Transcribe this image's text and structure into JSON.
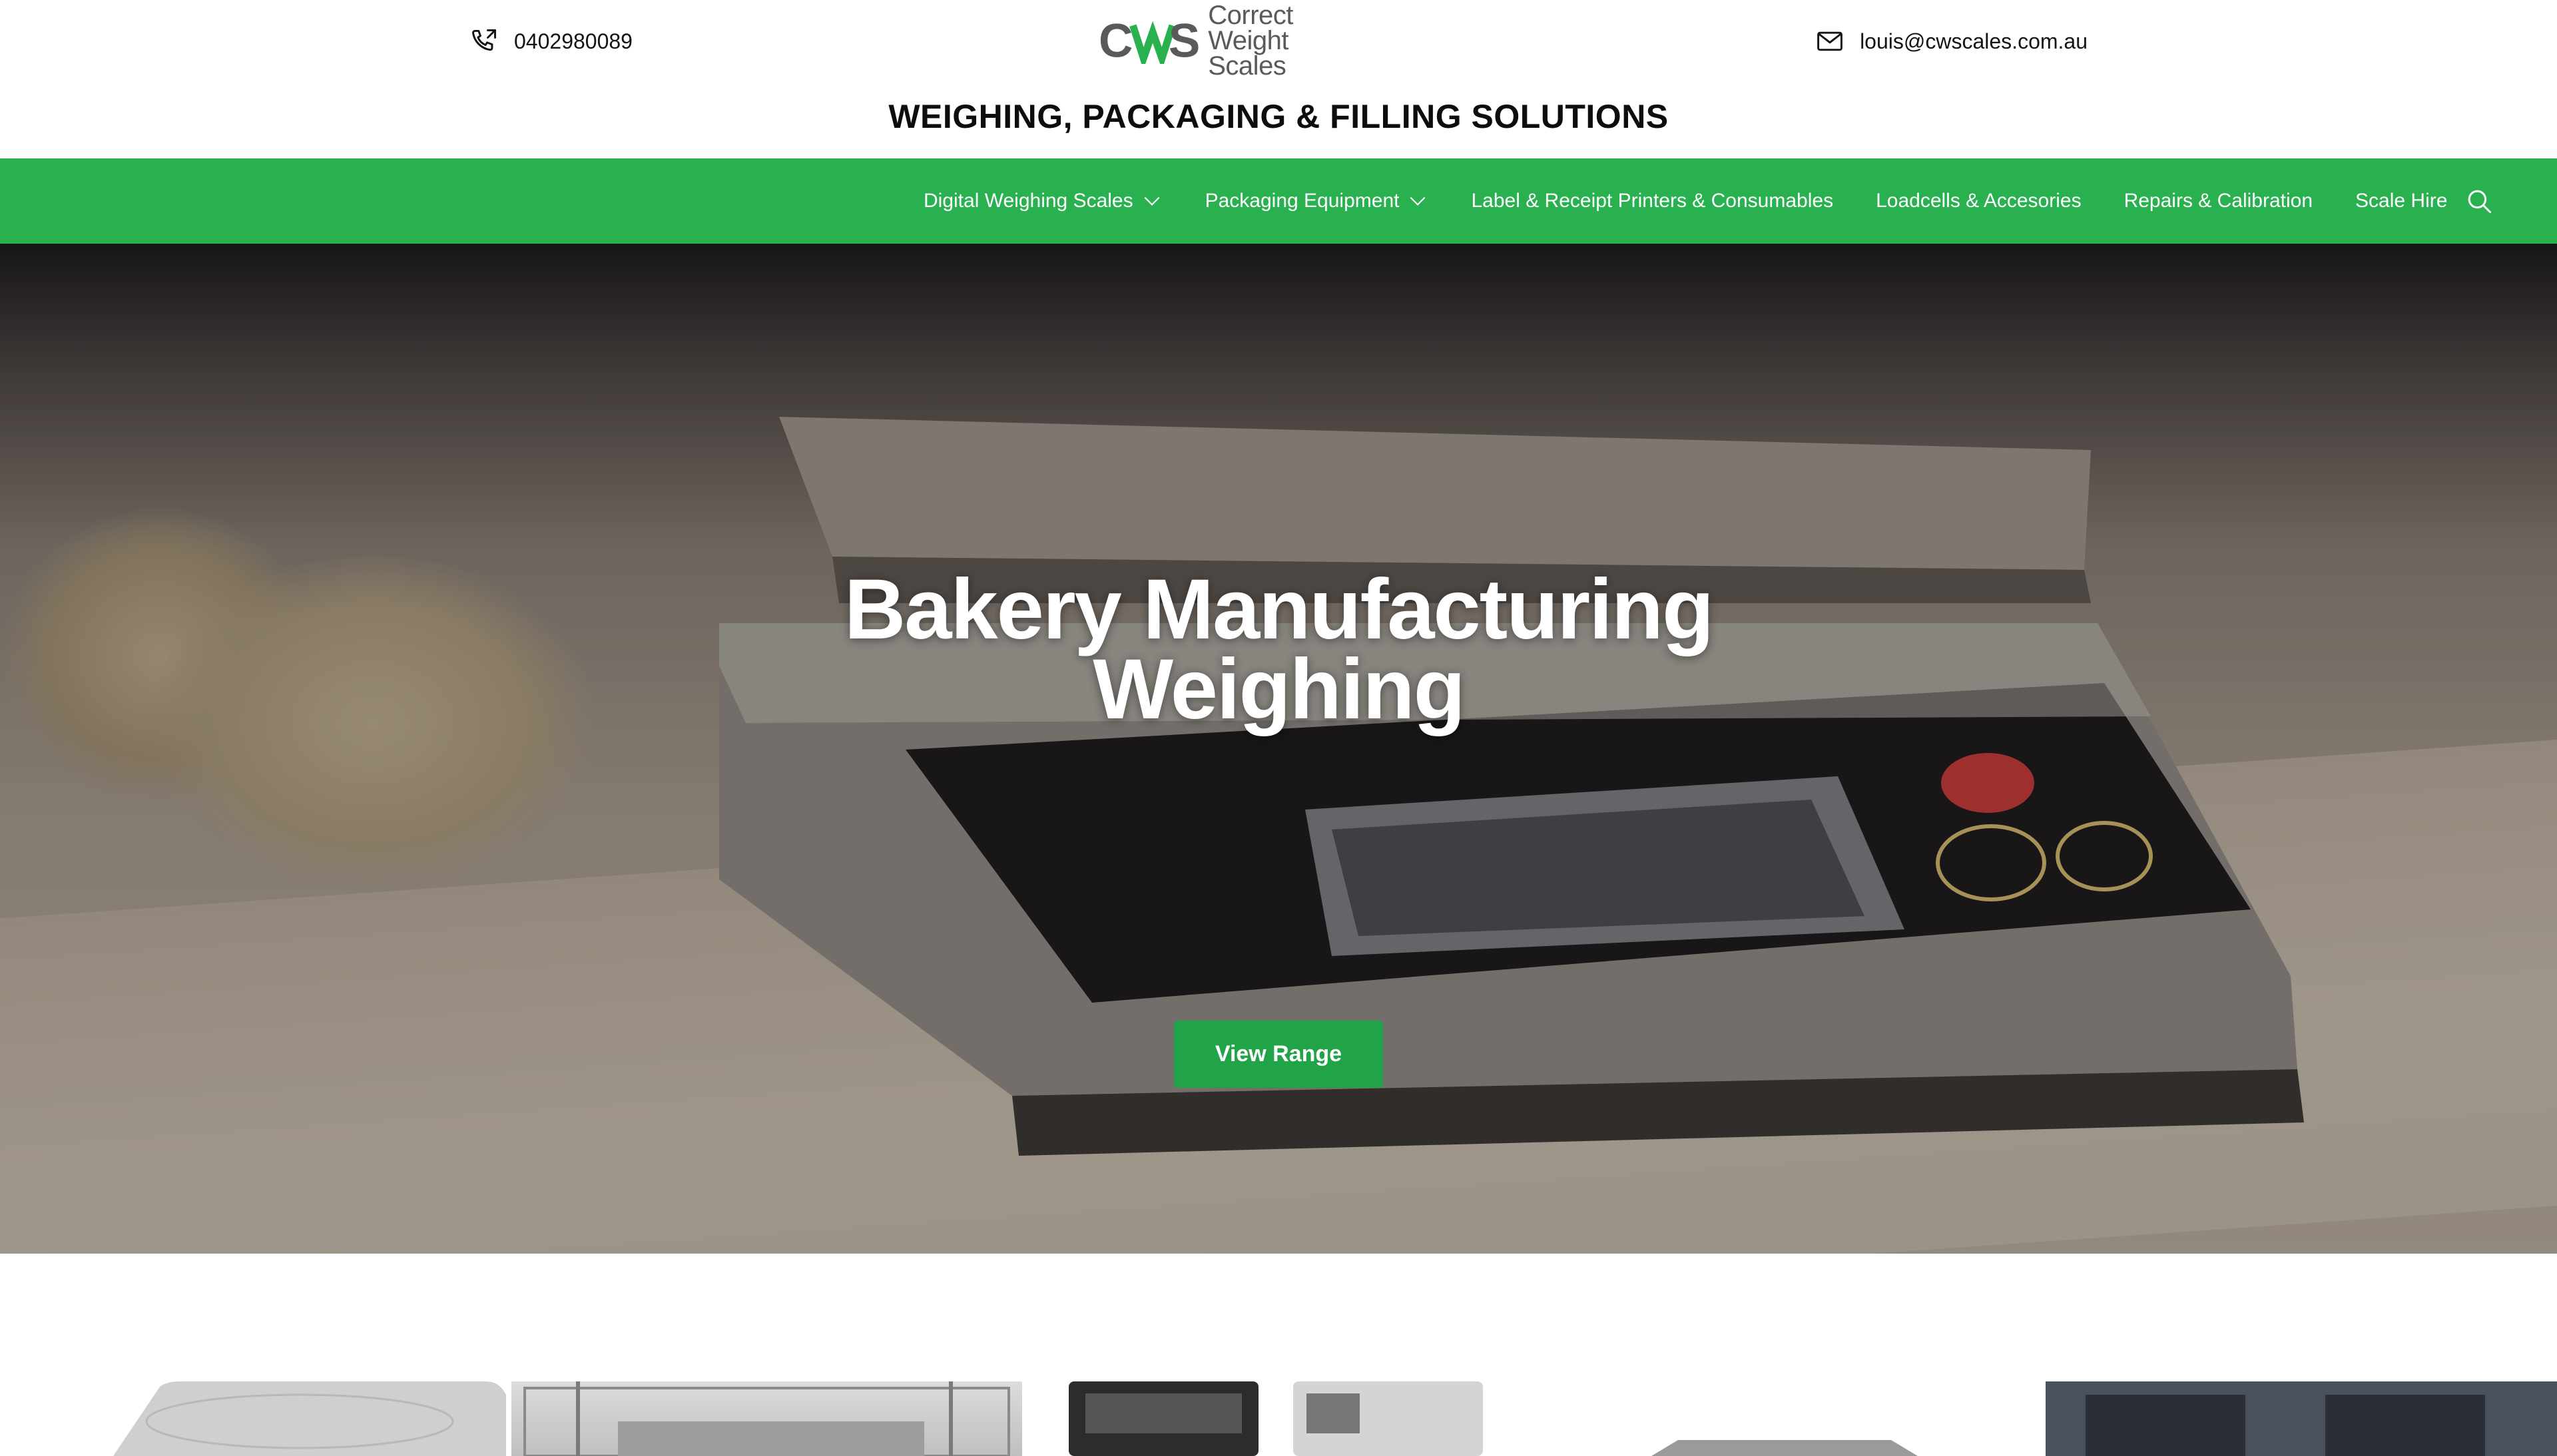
{
  "header": {
    "phone": "0402980089",
    "email": "louis@cwscales.com.au",
    "logo": {
      "mark": "CWS",
      "line1": "Correct",
      "line2": "Weight Scales"
    },
    "tagline": "WEIGHING, PACKAGING & FILLING SOLUTIONS"
  },
  "nav": {
    "items": [
      {
        "label": "Digital Weighing Scales",
        "dropdown": true
      },
      {
        "label": "Packaging Equipment",
        "dropdown": true
      },
      {
        "label": "Label & Receipt Printers & Consumables",
        "dropdown": false
      },
      {
        "label": "Loadcells & Accesories",
        "dropdown": false
      },
      {
        "label": "Repairs & Calibration",
        "dropdown": false
      },
      {
        "label": "Scale Hire",
        "dropdown": false
      }
    ],
    "search_icon": "search-icon"
  },
  "hero": {
    "title_line1": "Bakery Manufacturing",
    "title_line2": "Weighing",
    "cta_label": "View Range"
  },
  "colors": {
    "brand_green": "#29b14f",
    "button_green": "#21a347",
    "logo_grey": "#5a5a5a"
  },
  "icons": [
    "phone-icon",
    "mail-icon",
    "chevron-down-icon",
    "search-icon"
  ]
}
